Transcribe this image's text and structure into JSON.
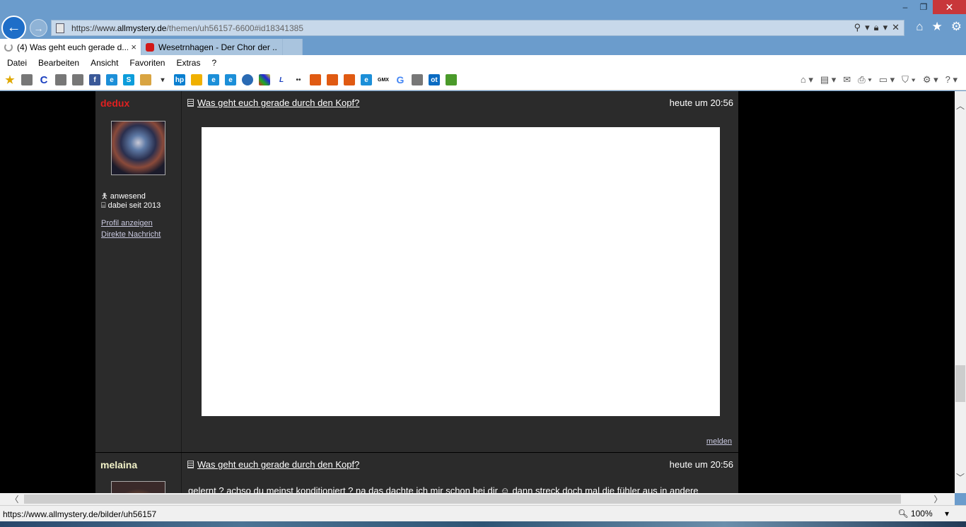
{
  "browser": {
    "url_domain_prefix": "https://www.",
    "url_domain": "allmystery.de",
    "url_path": "/themen/uh56157-6600#id18341385",
    "tabs": [
      {
        "title": "(4) Was geht euch gerade d...",
        "close": "×"
      },
      {
        "title": "Wesetrnhagen - Der Chor der ..."
      }
    ],
    "menu": [
      "Datei",
      "Bearbeiten",
      "Ansicht",
      "Favoriten",
      "Extras",
      "?"
    ],
    "window_controls": {
      "minimize": "–",
      "maximize": "❐",
      "close": "✕"
    },
    "status_url": "https://www.allmystery.de/bilder/uh56157",
    "zoom": "100%",
    "zoom_arrow": "▾"
  },
  "posts": [
    {
      "username": "dedux",
      "username_color": "#e02020",
      "status_presence": "anwesend",
      "status_since": "dabei seit 2013",
      "profile_link": "Profil anzeigen",
      "message_link": "Direkte Nachricht",
      "title": "Was geht euch gerade durch den Kopf?",
      "time": "heute um 20:56",
      "report": "melden"
    },
    {
      "username": "melaina",
      "username_color": "#f2f2c8",
      "title": "Was geht euch gerade durch den Kopf?",
      "time": "heute um 20:56",
      "body_before": "gelernt ? achso du meinst konditioniert ? na das dachte ich mir schon bei dir",
      "body_after": "dann streck doch mal die fühler aus in andere"
    }
  ]
}
